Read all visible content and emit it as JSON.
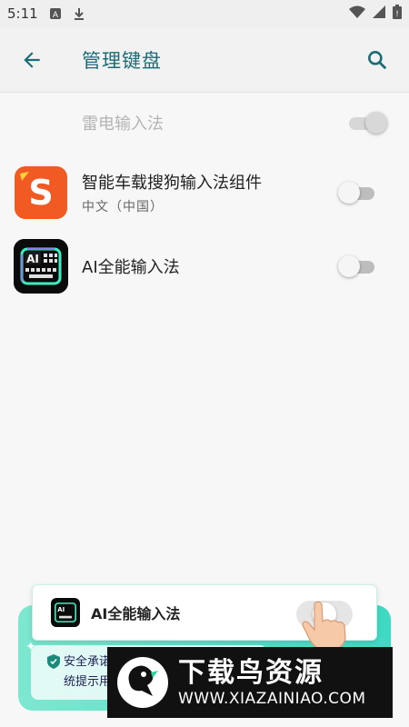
{
  "status_bar": {
    "time": "5:11"
  },
  "app_bar": {
    "title": "管理键盘"
  },
  "keyboards": [
    {
      "name": "雷电输入法",
      "subtitle": "",
      "enabled": true,
      "disabled": true
    },
    {
      "name": "智能车载搜狗输入法组件",
      "subtitle": "中文（中国）",
      "enabled": false,
      "disabled": false
    },
    {
      "name": "AI全能输入法",
      "subtitle": "",
      "enabled": false,
      "disabled": false
    }
  ],
  "overlay": {
    "card_label": "AI全能输入法",
    "promo_line1": "安全承诺",
    "promo_line2": "统提示用"
  },
  "watermark": {
    "title": "下载鸟资源",
    "url": "WWW.XIAZAINIAO.COM"
  },
  "colors": {
    "accent": "#1a6d74",
    "promo": "#3fd9c3"
  }
}
